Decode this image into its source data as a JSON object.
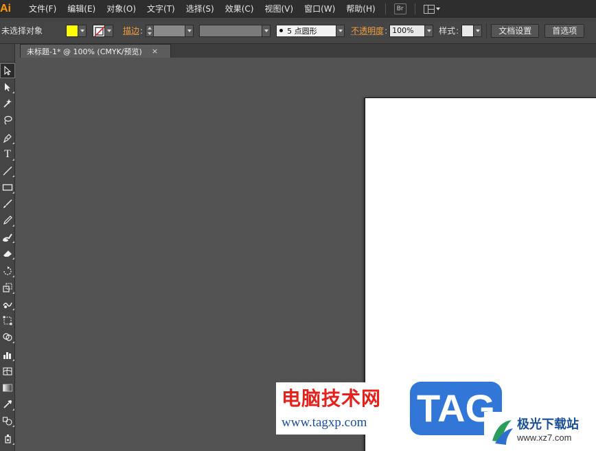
{
  "app": {
    "logo": "Ai"
  },
  "menu": {
    "items": [
      "文件(F)",
      "编辑(E)",
      "对象(O)",
      "文字(T)",
      "选择(S)",
      "效果(C)",
      "视图(V)",
      "窗口(W)",
      "帮助(H)"
    ],
    "bridge_label": "Br"
  },
  "control_bar": {
    "selection_status": "未选择对象",
    "fill_color": "#ffff00",
    "stroke_label": "描边",
    "brush_value": "5 点圆形",
    "opacity_label": "不透明度",
    "opacity_value": "100%",
    "style_label": "样式",
    "doc_setup_button": "文档设置",
    "prefs_button": "首选项"
  },
  "document": {
    "tab_title": "未标题-1* @ 100% (CMYK/预览)",
    "close_glyph": "×"
  },
  "watermark": {
    "site_name": "电脑技术网",
    "site_url": "www.tagxp.com",
    "tag_text": "TAG",
    "partner_name": "极光下载站",
    "partner_url": "www.xz7.com"
  },
  "colors": {
    "menubar_bg": "#2e2e2e",
    "panel_bg": "#454545",
    "canvas_bg": "#535353",
    "accent_orange": "#ff9a00",
    "watermark_red": "#e8201c",
    "watermark_blue": "#3277d8"
  }
}
